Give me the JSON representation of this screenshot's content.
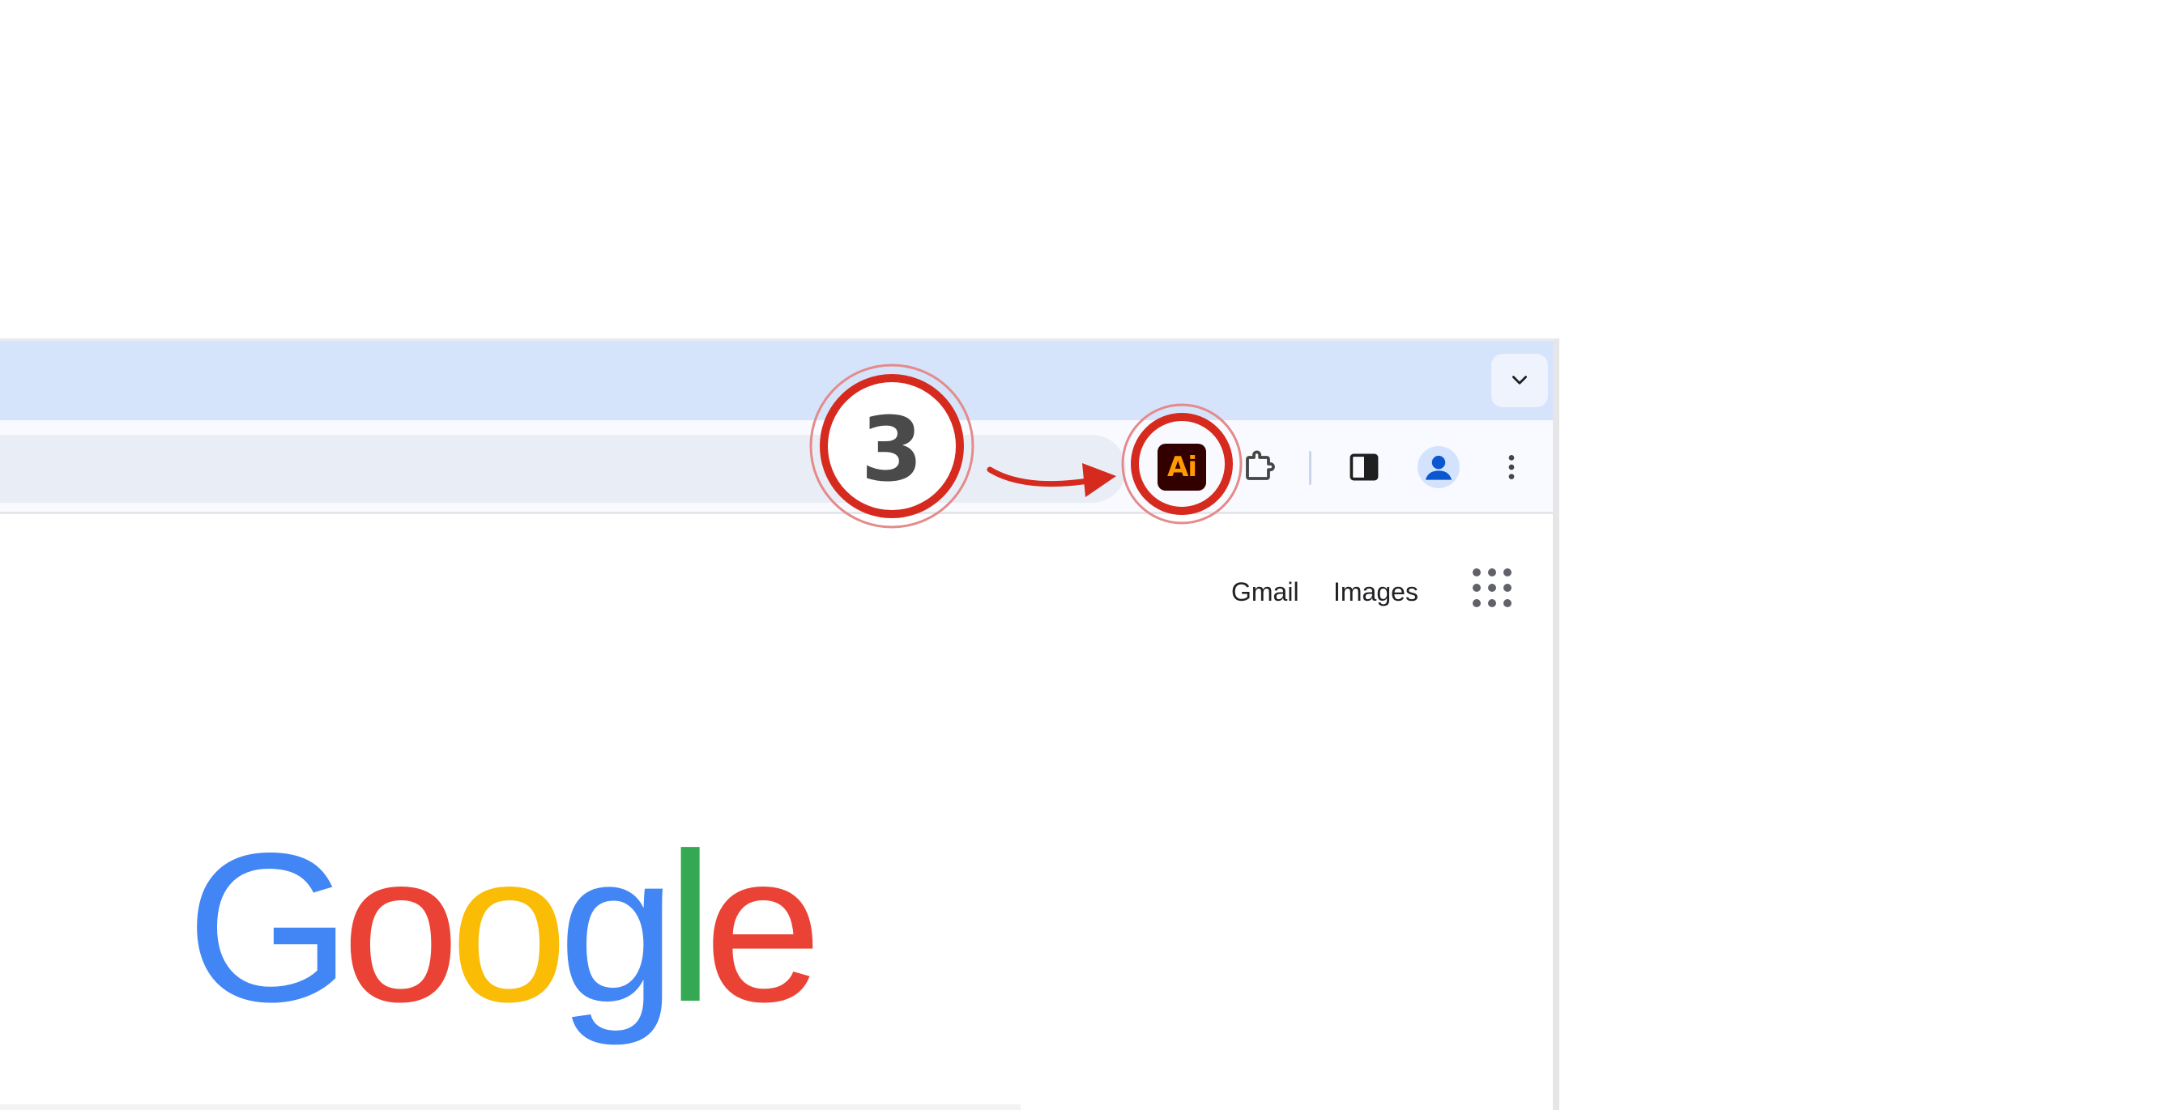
{
  "browser": {
    "toolbar": {
      "extension_label": "Ai"
    },
    "page": {
      "links": {
        "gmail": "Gmail",
        "images": "Images"
      },
      "logo_letters": [
        {
          "char": "G",
          "color": "#4285F4"
        },
        {
          "char": "o",
          "color": "#EA4335"
        },
        {
          "char": "o",
          "color": "#FBBC05"
        },
        {
          "char": "g",
          "color": "#4285F4"
        },
        {
          "char": "l",
          "color": "#34A853"
        },
        {
          "char": "e",
          "color": "#EA4335"
        }
      ]
    }
  },
  "annotation": {
    "step_number": "3",
    "accent_color": "#d62a1e"
  },
  "icons": [
    "chevron-down-icon",
    "adobe-illustrator-icon",
    "puzzle-icon",
    "side-panel-icon",
    "profile-icon",
    "more-vert-icon",
    "apps-grid-icon",
    "arrow-icon"
  ]
}
